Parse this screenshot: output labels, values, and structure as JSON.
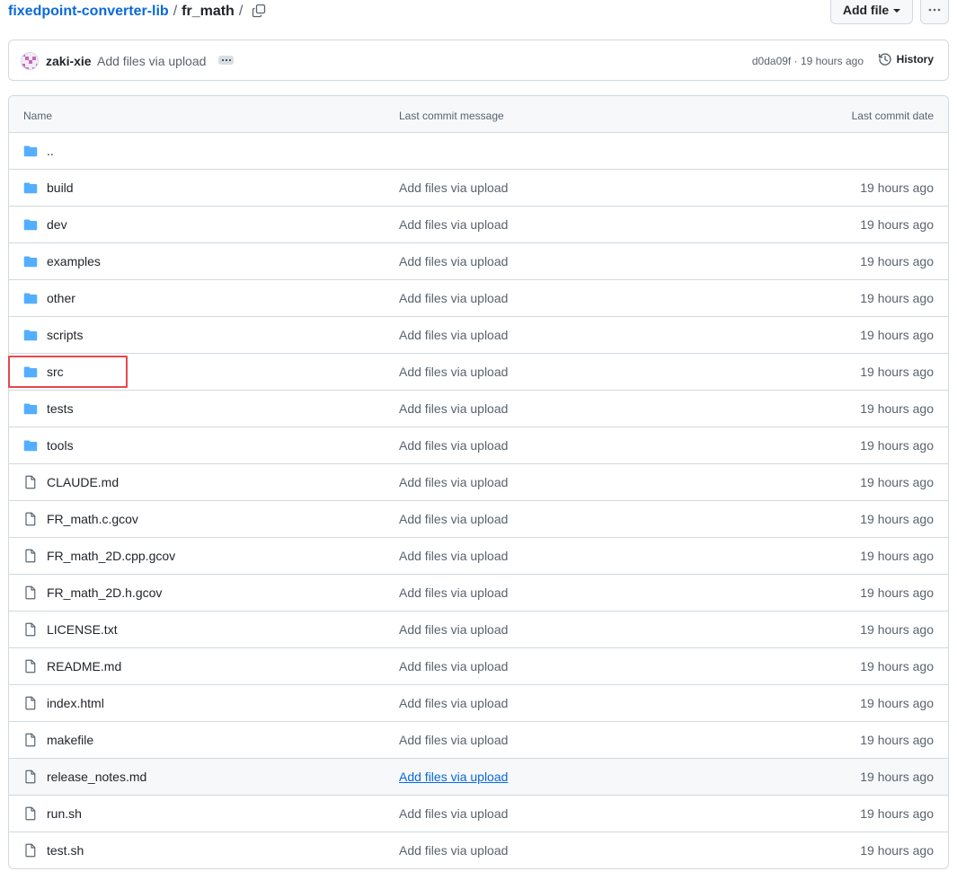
{
  "breadcrumb": {
    "repo": "fixedpoint-converter-lib",
    "separator": "/",
    "directory": "fr_math",
    "trailing_separator": "/"
  },
  "header": {
    "add_file_label": "Add file",
    "copy_icon": "copy-icon",
    "more_icon": "kebab-horizontal-icon"
  },
  "commit": {
    "author": "zaki-xie",
    "message": "Add files via upload",
    "sha": "d0da09f",
    "separator": " · ",
    "time": "19 hours ago",
    "history_label": "History"
  },
  "table": {
    "headers": {
      "name": "Name",
      "message": "Last commit message",
      "date": "Last commit date"
    },
    "rows": [
      {
        "type": "folder",
        "name": "..",
        "message": "",
        "date": ""
      },
      {
        "type": "folder",
        "name": "build",
        "message": "Add files via upload",
        "date": "19 hours ago"
      },
      {
        "type": "folder",
        "name": "dev",
        "message": "Add files via upload",
        "date": "19 hours ago"
      },
      {
        "type": "folder",
        "name": "examples",
        "message": "Add files via upload",
        "date": "19 hours ago"
      },
      {
        "type": "folder",
        "name": "other",
        "message": "Add files via upload",
        "date": "19 hours ago"
      },
      {
        "type": "folder",
        "name": "scripts",
        "message": "Add files via upload",
        "date": "19 hours ago"
      },
      {
        "type": "folder",
        "name": "src",
        "message": "Add files via upload",
        "date": "19 hours ago"
      },
      {
        "type": "folder",
        "name": "tests",
        "message": "Add files via upload",
        "date": "19 hours ago"
      },
      {
        "type": "folder",
        "name": "tools",
        "message": "Add files via upload",
        "date": "19 hours ago"
      },
      {
        "type": "file",
        "name": "CLAUDE.md",
        "message": "Add files via upload",
        "date": "19 hours ago"
      },
      {
        "type": "file",
        "name": "FR_math.c.gcov",
        "message": "Add files via upload",
        "date": "19 hours ago"
      },
      {
        "type": "file",
        "name": "FR_math_2D.cpp.gcov",
        "message": "Add files via upload",
        "date": "19 hours ago"
      },
      {
        "type": "file",
        "name": "FR_math_2D.h.gcov",
        "message": "Add files via upload",
        "date": "19 hours ago"
      },
      {
        "type": "file",
        "name": "LICENSE.txt",
        "message": "Add files via upload",
        "date": "19 hours ago"
      },
      {
        "type": "file",
        "name": "README.md",
        "message": "Add files via upload",
        "date": "19 hours ago"
      },
      {
        "type": "file",
        "name": "index.html",
        "message": "Add files via upload",
        "date": "19 hours ago"
      },
      {
        "type": "file",
        "name": "makefile",
        "message": "Add files via upload",
        "date": "19 hours ago"
      },
      {
        "type": "file",
        "name": "release_notes.md",
        "message": "Add files via upload",
        "date": "19 hours ago",
        "hovered": true
      },
      {
        "type": "file",
        "name": "run.sh",
        "message": "Add files via upload",
        "date": "19 hours ago"
      },
      {
        "type": "file",
        "name": "test.sh",
        "message": "Add files via upload",
        "date": "19 hours ago"
      }
    ]
  },
  "colors": {
    "link": "#0969da",
    "folder_icon": "#54aeff",
    "file_icon": "#59636e",
    "highlight_box": "#e5484d",
    "border": "#d1d9e0"
  }
}
